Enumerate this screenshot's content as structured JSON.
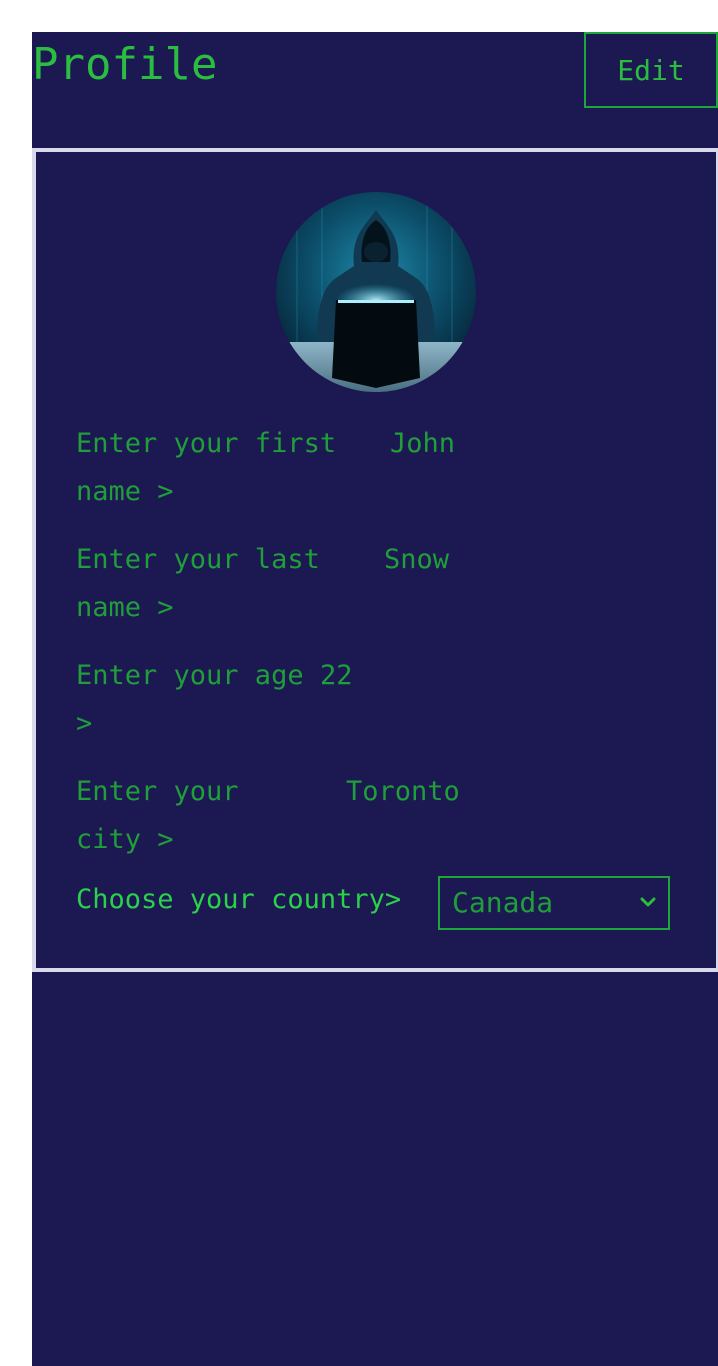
{
  "header": {
    "title": "Profile",
    "edit_label": "Edit"
  },
  "avatar": {
    "icon": "hacker-avatar-icon"
  },
  "fields": [
    {
      "label": "Enter your first name >",
      "value": "John"
    },
    {
      "label": "Enter your last name >",
      "value": "Snow"
    },
    {
      "label": "Enter your age >",
      "value": "22"
    },
    {
      "label": "Enter your city >",
      "value": "Toronto"
    }
  ],
  "country": {
    "label": "Choose your country>",
    "selected": "Canada",
    "icon": "chevron-down-icon"
  },
  "colors": {
    "background": "#1b1852",
    "accent": "#2bbd3f",
    "card_border": "#d9d9ea"
  }
}
